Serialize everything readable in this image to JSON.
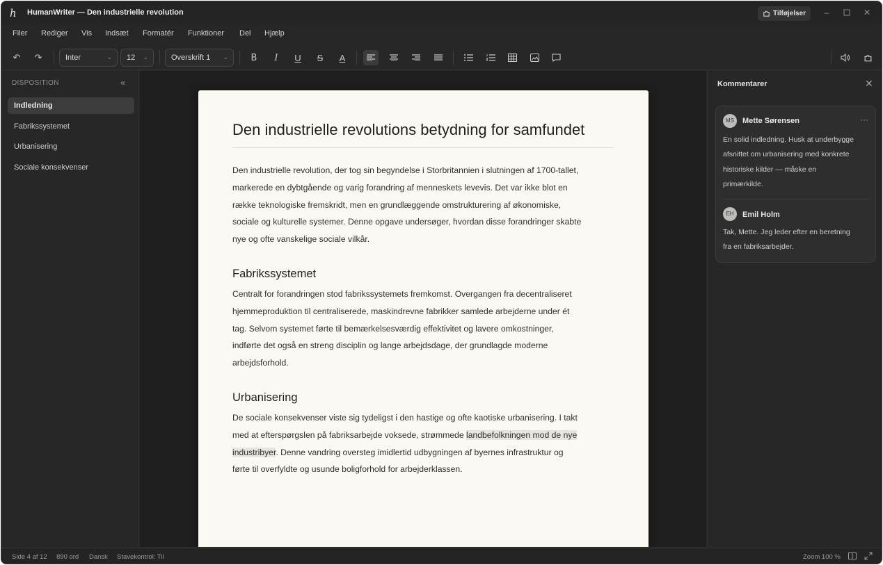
{
  "window": {
    "title": "HumanWriter — Den industrielle revolution",
    "addons_label": "Tilføjelser"
  },
  "menu": [
    "Filer",
    "Rediger",
    "Vis",
    "Indsæt",
    "Formatér",
    "Funktioner",
    "Del",
    "Hjælp"
  ],
  "toolbar": {
    "font": "Inter",
    "size": "12",
    "style": "Overskrift 1"
  },
  "sidebar": {
    "heading": "DISPOSITION",
    "items": [
      {
        "label": "Indledning",
        "active": true
      },
      {
        "label": "Fabrikssystemet"
      },
      {
        "label": "Urbanisering"
      },
      {
        "label": "Sociale konsekvenser"
      }
    ]
  },
  "document": {
    "title": "Den industrielle revolutions betydning for samfundet",
    "intro": [
      "Den industrielle revolution, der tog sin begyndelse i Storbritannien i slutningen af 1700-tallet,",
      "markerede en dybtgående og varig forandring af menneskets levevis. Det var ikke blot en",
      "række teknologiske fremskridt, men en grundlæggende omstrukturering af økonomiske,",
      "sociale og kulturelle systemer. Denne opgave undersøger, hvordan disse forandringer skabte",
      "nye og ofte vanskelige sociale vilkår."
    ],
    "section1_heading": "Fabrikssystemet",
    "section1": [
      "Centralt for forandringen stod fabrikssystemets fremkomst. Overgangen fra decentraliseret",
      "hjemmeproduktion til centraliserede, maskindrevne fabrikker samlede arbejderne under ét",
      "tag. Selvom systemet førte til bemærkelsesværdig effektivitet og lavere omkostninger,",
      "indførte det også en streng disciplin og lange arbejdsdage, der grundlagde moderne",
      "arbejdsforhold."
    ],
    "section2_heading": "Urbanisering",
    "section2": {
      "line1": "De sociale konsekvenser viste sig tydeligst i den hastige og ofte kaotiske urbanisering. I takt",
      "line2_pre": "med at efterspørgslen på fabriksarbejde voksede, strømmede ",
      "highlight_a": "landbefolkningen mod de nye",
      "highlight_b": "industribyer",
      "line3_post": ". Denne vandring oversteg imidlertid udbygningen af byernes infrastruktur og",
      "line4": "førte til overfyldte og usunde boligforhold for arbejderklassen."
    }
  },
  "comments": {
    "title": "Kommentarer",
    "thread": [
      {
        "initials": "MS",
        "author": "Mette Sørensen",
        "lines": [
          "En solid indledning. Husk at underbygge",
          "afsnittet om urbanisering med konkrete",
          "historiske kilder — måske en",
          "primærkilde."
        ]
      },
      {
        "initials": "EH",
        "author": "Emil Holm",
        "lines": [
          "Tak, Mette. Jeg leder efter en beretning",
          "fra en fabriksarbejder."
        ]
      }
    ]
  },
  "status": {
    "page": "Side 4 af 12",
    "words": "890 ord",
    "language": "Dansk",
    "spellcheck": "Stavekontrol: Til",
    "zoom": "Zoom 100 %"
  }
}
